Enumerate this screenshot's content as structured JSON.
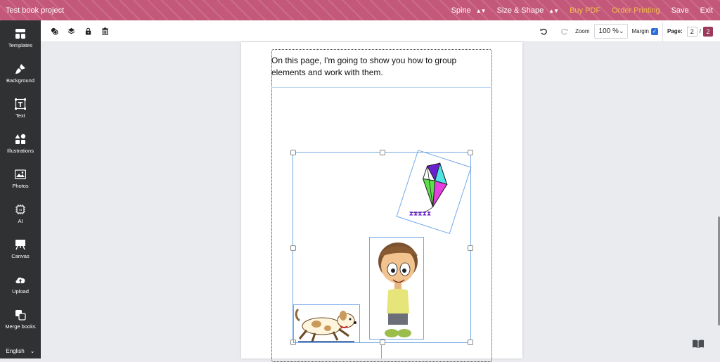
{
  "topbar": {
    "title": "Test book project",
    "menu": {
      "spine": "Spine",
      "size_shape": "Size & Shape",
      "buy_pdf": "Buy PDF",
      "order_printing": "Order Printing",
      "save": "Save",
      "exit": "Exit"
    }
  },
  "sidebar": {
    "items": [
      {
        "label": "Templates",
        "icon": "templates-icon"
      },
      {
        "label": "Background",
        "icon": "brush-icon"
      },
      {
        "label": "Text",
        "icon": "text-icon"
      },
      {
        "label": "Illustrations",
        "icon": "shapes-icon"
      },
      {
        "label": "Photos",
        "icon": "image-icon"
      },
      {
        "label": "AI",
        "icon": "ai-chip-icon"
      },
      {
        "label": "Canvas",
        "icon": "easel-icon"
      },
      {
        "label": "Upload",
        "icon": "cloud-upload-icon"
      },
      {
        "label": "Merge books",
        "icon": "merge-icon"
      }
    ],
    "language": "English"
  },
  "toolbar": {
    "zoom_label": "Zoom",
    "zoom_value": "100 %",
    "margin_label": "Margin",
    "margin_checked": true,
    "page_label": "Page:",
    "page_current": "2",
    "page_separator": "/",
    "page_total": "2"
  },
  "page": {
    "text": "On this page, I'm going to show you how to group elements and work with them."
  },
  "colors": {
    "topbar": "#c4587a",
    "accent_orange": "#f3c04c",
    "sidebar": "#2f3133",
    "selection": "#74a9e6"
  }
}
